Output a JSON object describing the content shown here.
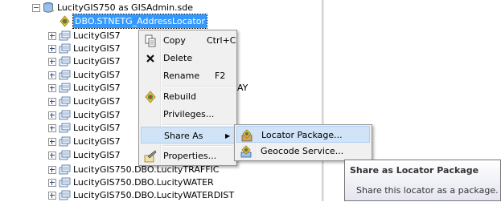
{
  "tree": {
    "root_label": "LucityGIS750 as GISAdmin.sde",
    "selected_label": "DBO.STNETG_AddressLocator",
    "item_prefix": "LucityGIS7",
    "partial_suffix": "AY",
    "items_bottom": [
      "LucityGIS750.DBO.LucityTRAFFIC",
      "LucityGIS750.DBO.LucityWATER",
      "LucityGIS750.DBO.LucityWATERDIST"
    ]
  },
  "context_menu": {
    "items": [
      {
        "label": "Copy",
        "shortcut": "Ctrl+C",
        "icon": "copy-icon"
      },
      {
        "label": "Delete",
        "shortcut": "",
        "icon": "delete-x-icon"
      },
      {
        "label": "Rename",
        "shortcut": "F2",
        "icon": ""
      },
      {
        "label": "Rebuild",
        "shortcut": "",
        "icon": "rebuild-locator-icon"
      },
      {
        "label": "Privileges...",
        "shortcut": "",
        "icon": ""
      },
      {
        "label": "Share As",
        "shortcut": "",
        "icon": "",
        "submenu_arrow": "▶"
      },
      {
        "label": "Properties...",
        "shortcut": "",
        "icon": "properties-icon"
      }
    ]
  },
  "submenu": {
    "items": [
      {
        "label": "Locator Package...",
        "icon": "locator-package-icon"
      },
      {
        "label": "Geocode Service...",
        "icon": "geocode-service-icon"
      }
    ]
  },
  "tooltip": {
    "title": "Share as Locator Package",
    "body": "Share this locator as a package."
  },
  "colors": {
    "selection": "#3399ff",
    "menu_bg": "#f0f0f0",
    "menu_highlight": "#d1e3f7"
  }
}
